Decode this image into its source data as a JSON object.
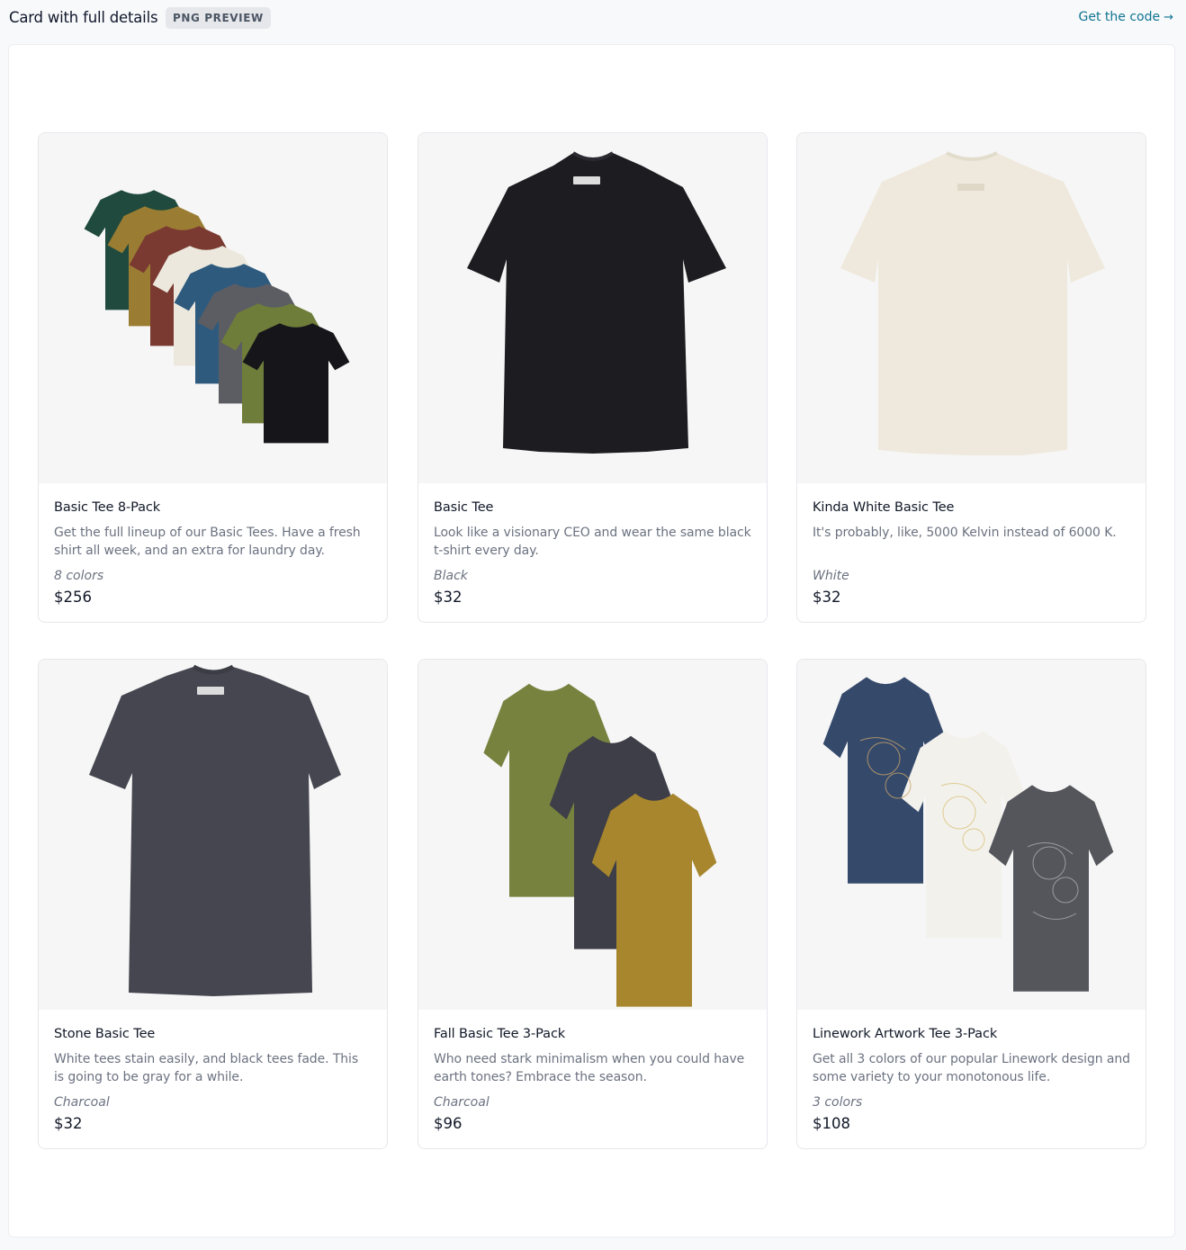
{
  "header": {
    "title": "Card with full details",
    "badge": "PNG PREVIEW",
    "code_link": "Get the code",
    "code_arrow": "→"
  },
  "colors": {
    "link": "#0e7490",
    "badge_bg": "#e5e7eb",
    "text_muted": "#6b7280"
  },
  "products": [
    {
      "name": "Basic Tee 8-Pack",
      "description": "Get the full lineup of our Basic Tees. Have a fresh shirt all week, and an extra for laundry day.",
      "options": "8 colors",
      "price": "$256",
      "image": "stack-of-8-tees"
    },
    {
      "name": "Basic Tee",
      "description": "Look like a visionary CEO and wear the same black t-shirt every day.",
      "options": "Black",
      "price": "$32",
      "image": "black-tee"
    },
    {
      "name": "Kinda White Basic Tee",
      "description": "It's probably, like, 5000 Kelvin instead of 6000 K.",
      "options": "White",
      "price": "$32",
      "image": "white-tee"
    },
    {
      "name": "Stone Basic Tee",
      "description": "White tees stain easily, and black tees fade. This is going to be gray for a while.",
      "options": "Charcoal",
      "price": "$32",
      "image": "charcoal-tee"
    },
    {
      "name": "Fall Basic Tee 3-Pack",
      "description": "Who need stark minimalism when you could have earth tones? Embrace the season.",
      "options": "Charcoal",
      "price": "$96",
      "image": "three-earth-tone-tees"
    },
    {
      "name": "Linework Artwork Tee 3-Pack",
      "description": "Get all 3 colors of our popular Linework design and some variety to your monotonous life.",
      "options": "3 colors",
      "price": "$108",
      "image": "three-linework-tees"
    }
  ]
}
